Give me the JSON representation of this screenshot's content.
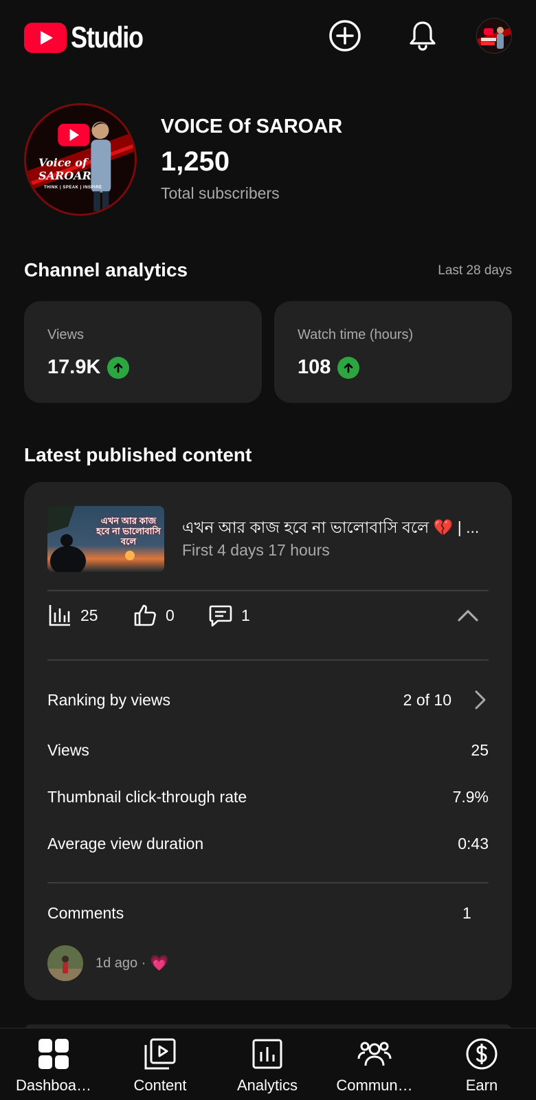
{
  "header": {
    "app_name": "Studio",
    "create_icon": "plus-circle-icon",
    "notifications_icon": "bell-icon",
    "brand_color": "#ff0033"
  },
  "channel": {
    "name": "VOICE Of SAROAR",
    "subscribers": "1,250",
    "subscribers_label": "Total subscribers",
    "avatar_text": "Voice of SAROAR",
    "avatar_tagline": "THINK | SPEAK | INSPIRE"
  },
  "analytics": {
    "title": "Channel analytics",
    "period": "Last 28 days",
    "cards": [
      {
        "label": "Views",
        "value": "17.9K",
        "trend": "up"
      },
      {
        "label": "Watch time (hours)",
        "value": "108",
        "trend": "up"
      }
    ],
    "trend_color": "#2ba640"
  },
  "latest": {
    "section_title": "Latest published content",
    "video": {
      "title": "এখন আর কাজ হবে না ভালোবাসি বলে 💔 | ...",
      "subtitle": "First 4 days 17 hours",
      "thumbnail_text": "এখন আর কাজ হবে না ভালোবাসি বলে"
    },
    "metrics": {
      "views": "25",
      "likes": "0",
      "comments": "1"
    },
    "details": {
      "ranking_label": "Ranking by views",
      "ranking_value": "2 of 10",
      "views_label": "Views",
      "views_value": "25",
      "ctr_label": "Thumbnail click-through rate",
      "ctr_value": "7.9%",
      "avd_label": "Average view duration",
      "avd_value": "0:43"
    },
    "comments": {
      "label": "Comments",
      "count": "1",
      "latest_meta": "1d ago ·",
      "latest_emoji": "💗"
    }
  },
  "nav": {
    "items": [
      {
        "label": "Dashboa…",
        "icon": "dashboard-icon"
      },
      {
        "label": "Content",
        "icon": "content-icon"
      },
      {
        "label": "Analytics",
        "icon": "analytics-icon"
      },
      {
        "label": "Commun…",
        "icon": "community-icon"
      },
      {
        "label": "Earn",
        "icon": "earn-icon"
      }
    ]
  }
}
